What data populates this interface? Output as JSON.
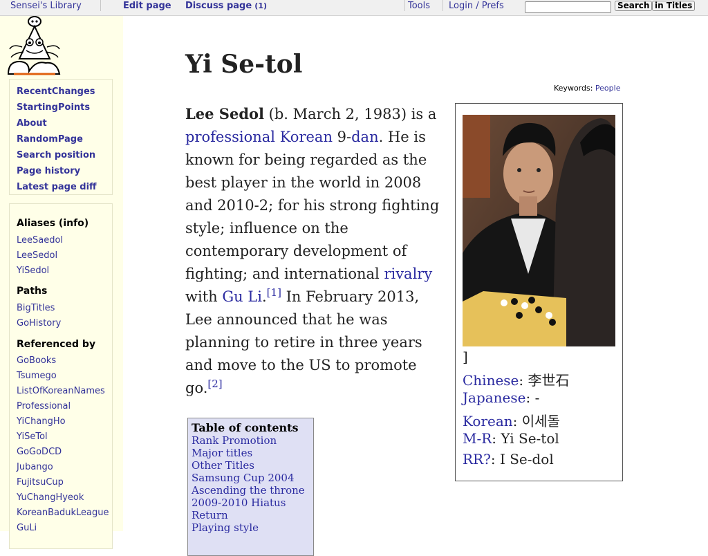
{
  "topbar": {
    "site": "Sensei's Library",
    "edit": "Edit page",
    "discuss": "Discuss page",
    "discuss_count": "(1)",
    "tools": "Tools",
    "login": "Login / Prefs",
    "search_value": "",
    "search_button": "Search",
    "titles_button": "in Titles"
  },
  "sidebar": {
    "nav": [
      "RecentChanges",
      "StartingPoints",
      "About",
      "RandomPage",
      "Search position",
      "Page history",
      "Latest page diff"
    ],
    "aliases_heading": "Aliases (info)",
    "aliases": [
      "LeeSaedol",
      "LeeSedol",
      "YiSedol"
    ],
    "paths_heading": "Paths",
    "paths": [
      "BigTitles",
      "GoHistory"
    ],
    "referenced_heading": "Referenced by",
    "referenced": [
      "GoBooks",
      "Tsumego",
      "ListOfKoreanNames",
      "Professional",
      "YiChangHo",
      "YiSeTol",
      "GoGoDCD",
      "Jubango",
      "FujitsuCup",
      "YuChangHyeok",
      "KoreanBadukLeague",
      "GuLi"
    ]
  },
  "main": {
    "title": "Yi Se-tol",
    "keywords_label": "Keywords",
    "keywords_value": "People",
    "body": {
      "name": "Lee Sedol",
      "t1": " (b. March 2, 1983) is a ",
      "l1": "professional",
      "t2": " ",
      "l2": "Korean",
      "t3": " 9-",
      "l3": "dan",
      "t4": ". He is known for being regarded as the best player in the world in 2008 and 2010-2; for his strong fighting style; influence on the contemporary development of fighting; and international ",
      "l4": "rivalry",
      "t5": " with ",
      "l5": "Gu Li",
      "t6": ".",
      "ref1": "[1]",
      "t7": " In February 2013, Lee announced that he was planning to retire in three years and move to the US to promote go.",
      "ref2": "[2]"
    }
  },
  "infobox": {
    "bracket": "]",
    "names": [
      {
        "label": "Chinese",
        "value": ": 李世石"
      },
      {
        "label": "Japanese",
        "value": ": -"
      },
      {
        "label": "Korean",
        "value": ": 이세돌"
      },
      {
        "label": "M-R",
        "value": ": Yi Se-tol"
      },
      {
        "label": "RR?",
        "value": ": I Se-dol"
      }
    ]
  },
  "toc": {
    "title": "Table of contents",
    "items": [
      "Rank Promotion",
      "Major titles",
      "Other Titles",
      "Samsung Cup 2004",
      "Ascending the throne",
      "2009-2010 Hiatus",
      "Return",
      "Playing style"
    ]
  }
}
